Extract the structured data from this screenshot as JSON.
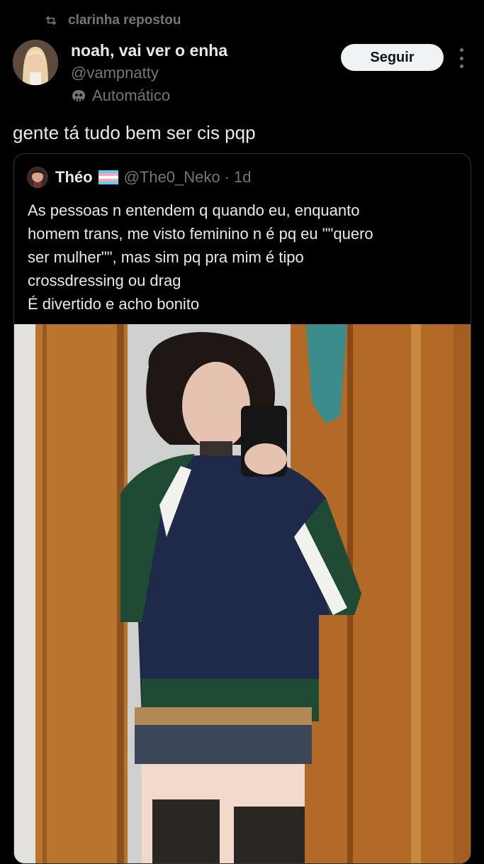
{
  "repost": {
    "label": "clarinha repostou",
    "icon": "repost-icon"
  },
  "author": {
    "display_name": "noah, vai ver o enha",
    "handle": "@vampnatty",
    "automated_label": "Automático",
    "automated_icon": "bot-icon"
  },
  "actions": {
    "follow_label": "Seguir",
    "more_icon": "more-icon"
  },
  "tweet": {
    "text": "gente tá tudo bem ser cis pqp"
  },
  "quoted": {
    "name": "Théo",
    "flag_icon": "trans-flag-icon",
    "handle": "@The0_Neko",
    "separator": "·",
    "time": "1d",
    "lines": [
      "As pessoas n entendem q quando eu, enquanto",
      "homem trans, me visto feminino n é pq eu \"\"quero",
      "ser mulher\"\", mas sim pq pra mim é tipo",
      "crossdressing ou drag",
      "É divertido e acho bonito"
    ]
  },
  "colors": {
    "background": "#000000",
    "text": "#e7e9ea",
    "secondary": "#71767b",
    "border": "#2f3336",
    "button_bg": "#eff3f4",
    "button_text": "#0f1419"
  }
}
